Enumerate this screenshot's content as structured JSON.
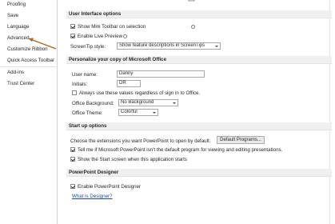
{
  "sidebar": {
    "items": [
      "Proofing",
      "Save",
      "Language",
      "Advanced",
      "Customize Ribbon",
      "Quick Access Toolbar",
      "Add-ins",
      "Trust Center"
    ]
  },
  "ui_options": {
    "header": "User Interface options",
    "mini_toolbar": "Show Mini Toolbar on selection",
    "live_preview": "Enable Live Preview",
    "screentip_label": "ScreenTip style:",
    "screentip_value": "Show feature descriptions in ScreenTips"
  },
  "personalize": {
    "header": "Personalize your copy of Microsoft Office",
    "username_label": "User name:",
    "username_value": "Danny",
    "initials_label": "Initials:",
    "initials_value": "DR",
    "always_use": "Always use these values regardless of sign in to Office.",
    "background_label": "Office Background:",
    "background_value": "No Background",
    "theme_label": "Office Theme:",
    "theme_value": "Colorful"
  },
  "startup": {
    "header": "Start up options",
    "extensions_text": "Choose the extensions you want PowerPoint to open by default:",
    "default_programs": "Default Programs...",
    "tell_me": "Tell me if Microsoft PowerPoint isn't the default program for viewing and editing presentations.",
    "show_start": "Show the Start screen when this application starts"
  },
  "designer": {
    "header": "PowerPoint Designer",
    "enable": "Enable PowerPoint Designer",
    "what_is": "What is Designer?"
  },
  "colors": {
    "annotation_arrow": "#b5651d",
    "accent_link": "#1f4e9e"
  }
}
